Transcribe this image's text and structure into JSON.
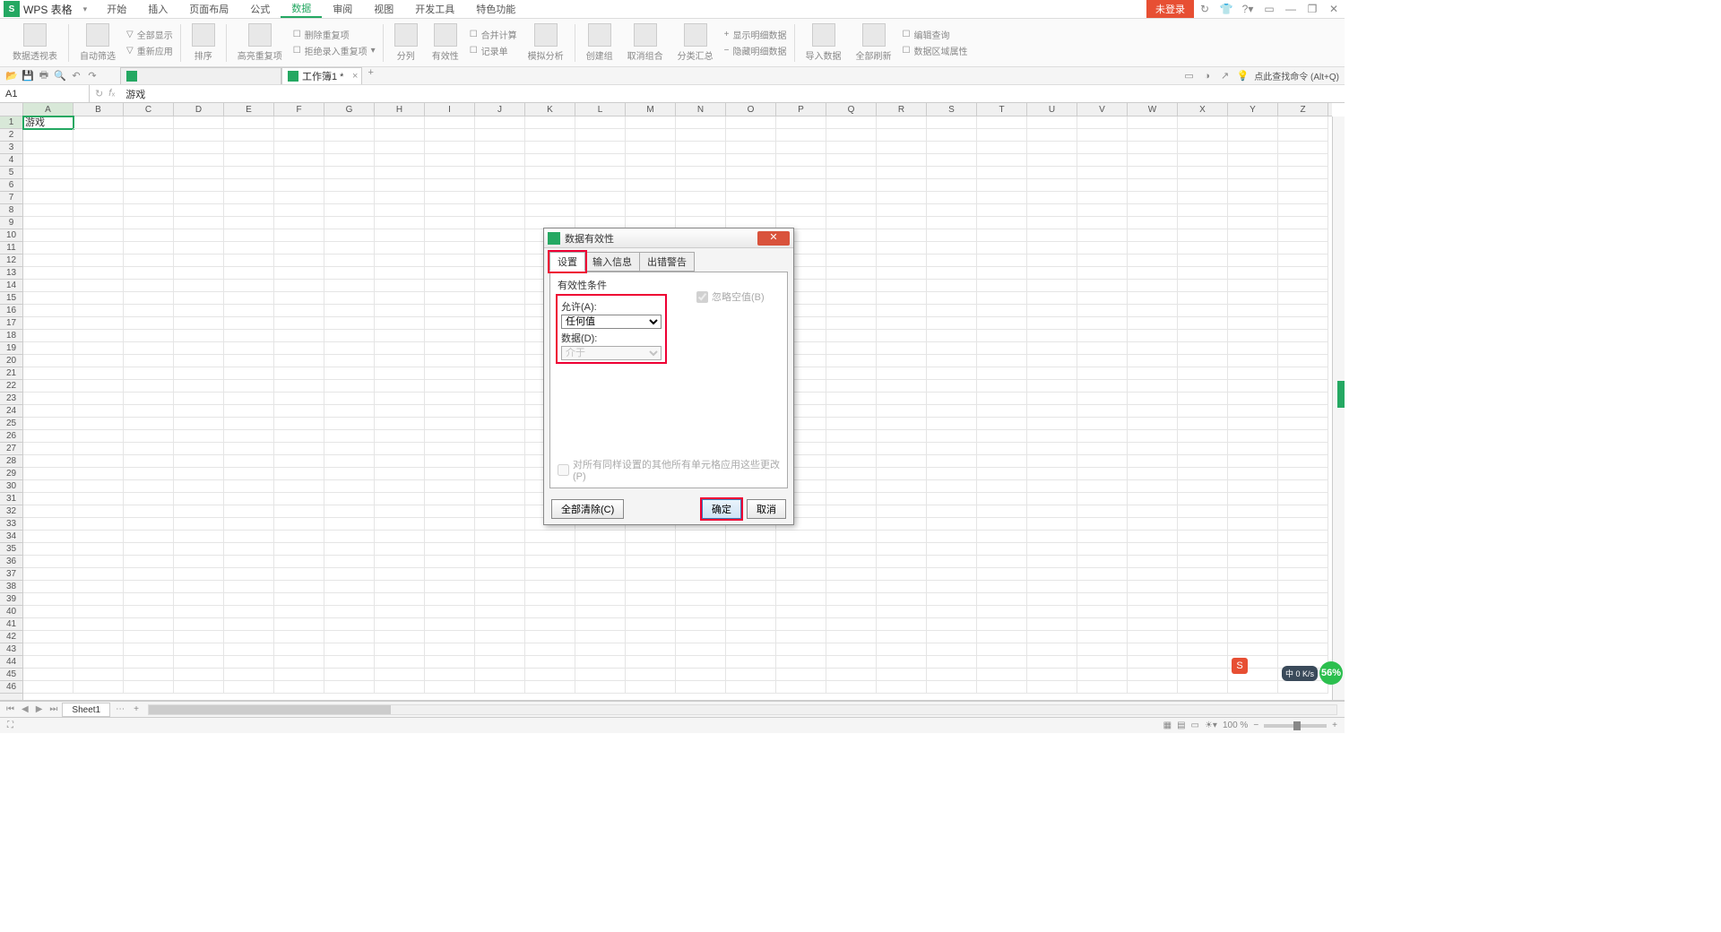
{
  "app": {
    "name": "WPS 表格",
    "login": "未登录"
  },
  "menu": [
    "开始",
    "插入",
    "页面布局",
    "公式",
    "数据",
    "审阅",
    "视图",
    "开发工具",
    "特色功能"
  ],
  "menu_active": 4,
  "ribbon": {
    "pivotTable": "数据透视表",
    "autoFilter": "自动筛选",
    "showAll": "全部显示",
    "reapply": "重新应用",
    "sort": "排序",
    "highlightDup": "高亮重复项",
    "removeDup": "删除重复项",
    "rejectDup": "拒绝录入重复项",
    "textToCol": "分列",
    "validity": "有效性",
    "consolidate": "合并计算",
    "record": "记录单",
    "whatIf": "模拟分析",
    "group": "创建组",
    "ungroup": "取消组合",
    "subtotal": "分类汇总",
    "showDetail": "显示明细数据",
    "hideDetail": "隐藏明细数据",
    "importData": "导入数据",
    "refreshAll": "全部刷新",
    "editQuery": "编辑查询",
    "regionProp": "数据区域属性"
  },
  "docTabs": {
    "blurred": "",
    "active": "工作簿1 *"
  },
  "search": {
    "placeholder": "点此查找命令 (Alt+Q)"
  },
  "nameBox": "A1",
  "formulaValue": "游戏",
  "cellA1": "游戏",
  "columns": [
    "A",
    "B",
    "C",
    "D",
    "E",
    "F",
    "G",
    "H",
    "I",
    "J",
    "K",
    "L",
    "M",
    "N",
    "O",
    "P",
    "Q",
    "R",
    "S",
    "T",
    "U",
    "V",
    "W",
    "X",
    "Y",
    "Z"
  ],
  "sheet": {
    "name": "Sheet1"
  },
  "zoom": "100 %",
  "dialog": {
    "title": "数据有效性",
    "tabs": [
      "设置",
      "输入信息",
      "出错警告"
    ],
    "section": "有效性条件",
    "allowLabel": "允许(A):",
    "allowValue": "任何值",
    "dataLabel": "数据(D):",
    "dataValue": "介于",
    "ignoreBlank": "忽略空值(B)",
    "applyAll": "对所有同样设置的其他所有单元格应用这些更改(P)",
    "clearAll": "全部清除(C)",
    "ok": "确定",
    "cancel": "取消"
  },
  "tray": {
    "percent": "56%",
    "net": "0 K/s"
  },
  "ime": "S"
}
